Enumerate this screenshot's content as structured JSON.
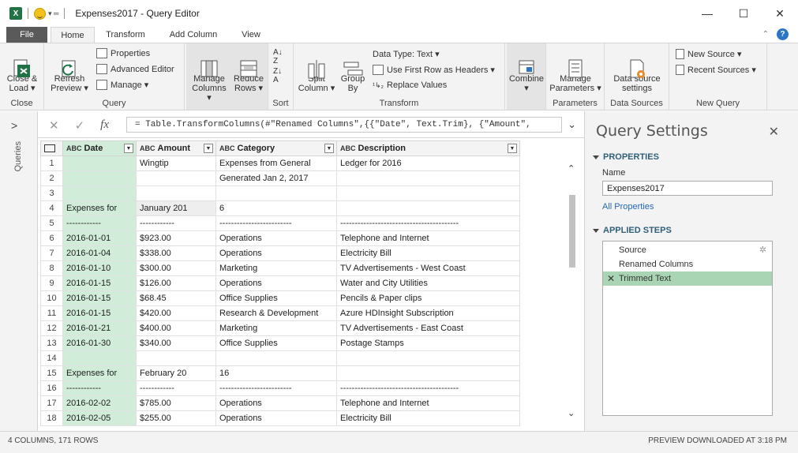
{
  "window": {
    "app_badge": "X",
    "title": "Expenses2017 - Query Editor",
    "controls": {
      "minimize": "—",
      "maximize": "☐",
      "close": "✕"
    }
  },
  "ribbon_tabs": [
    {
      "label": "File"
    },
    {
      "label": "Home"
    },
    {
      "label": "Transform"
    },
    {
      "label": "Add Column"
    },
    {
      "label": "View"
    }
  ],
  "ribbon": {
    "close_group": {
      "label": "Close",
      "close_load": "Close &\nLoad ▾"
    },
    "query_group": {
      "label": "Query",
      "refresh_preview": "Refresh\nPreview ▾",
      "properties": "Properties",
      "advanced_editor": "Advanced Editor",
      "manage": "Manage ▾"
    },
    "manage_columns": "Manage\nColumns ▾",
    "reduce_rows": "Reduce\nRows ▾",
    "sort_group": {
      "label": "Sort"
    },
    "transform_group": {
      "label": "Transform",
      "split_column": "Split\nColumn ▾",
      "group_by": "Group\nBy",
      "data_type": "Data Type: Text ▾",
      "use_first_row": "Use First Row as Headers ▾",
      "replace_values": "Replace Values"
    },
    "combine": "Combine\n▾",
    "parameters_group": {
      "label": "Parameters",
      "manage_parameters": "Manage\nParameters ▾"
    },
    "data_sources_group": {
      "label": "Data Sources",
      "data_source_settings": "Data source\nsettings"
    },
    "new_query_group": {
      "label": "New Query",
      "new_source": "New Source ▾",
      "recent_sources": "Recent Sources ▾"
    }
  },
  "queries_pane": {
    "label": "Queries",
    "chevron": ">"
  },
  "formula_bar": {
    "cancel_icon": "✕",
    "commit_icon": "✓",
    "fx_label": "fx",
    "formula": "= Table.TransformColumns(#\"Renamed Columns\",{{\"Date\", Text.Trim}, {\"Amount\","
  },
  "grid": {
    "columns": [
      {
        "type": "ABC",
        "label": "Date"
      },
      {
        "type": "ABC",
        "label": "Amount"
      },
      {
        "type": "ABC",
        "label": "Category"
      },
      {
        "type": "ABC",
        "label": "Description"
      }
    ],
    "rows": [
      {
        "n": "1",
        "date": "",
        "amount": "Wingtip",
        "category": "Expenses from General",
        "description": "Ledger for 2016"
      },
      {
        "n": "2",
        "date": "",
        "amount": "",
        "category": "Generated Jan 2, 2017",
        "description": ""
      },
      {
        "n": "3",
        "date": "",
        "amount": "",
        "category": "",
        "description": ""
      },
      {
        "n": "4",
        "date": "Expenses for",
        "amount": "January 201",
        "category": "6",
        "description": ""
      },
      {
        "n": "5",
        "date": "------------",
        "amount": "------------",
        "category": "-------------------------",
        "description": "-----------------------------------------"
      },
      {
        "n": "6",
        "date": "2016-01-01",
        "amount": "$923.00",
        "category": "Operations",
        "description": "Telephone and Internet"
      },
      {
        "n": "7",
        "date": "2016-01-04",
        "amount": "$338.00",
        "category": "Operations",
        "description": "Electricity Bill"
      },
      {
        "n": "8",
        "date": "2016-01-10",
        "amount": "$300.00",
        "category": "Marketing",
        "description": "TV Advertisements - West Coast"
      },
      {
        "n": "9",
        "date": "2016-01-15",
        "amount": "$126.00",
        "category": "Operations",
        "description": "Water and City Utilities"
      },
      {
        "n": "10",
        "date": "2016-01-15",
        "amount": "$68.45",
        "category": "Office Supplies",
        "description": "Pencils & Paper clips"
      },
      {
        "n": "11",
        "date": "2016-01-15",
        "amount": "$420.00",
        "category": "Research & Development",
        "description": "Azure HDInsight Subscription"
      },
      {
        "n": "12",
        "date": "2016-01-21",
        "amount": "$400.00",
        "category": "Marketing",
        "description": "TV Advertisements - East Coast"
      },
      {
        "n": "13",
        "date": "2016-01-30",
        "amount": "$340.00",
        "category": "Office Supplies",
        "description": "Postage Stamps"
      },
      {
        "n": "14",
        "date": "",
        "amount": "",
        "category": "",
        "description": ""
      },
      {
        "n": "15",
        "date": "Expenses for",
        "amount": "February 20",
        "category": "16",
        "description": ""
      },
      {
        "n": "16",
        "date": "------------",
        "amount": "------------",
        "category": "-------------------------",
        "description": "-----------------------------------------"
      },
      {
        "n": "17",
        "date": "2016-02-02",
        "amount": "$785.00",
        "category": "Operations",
        "description": "Telephone and Internet"
      },
      {
        "n": "18",
        "date": "2016-02-05",
        "amount": "$255.00",
        "category": "Operations",
        "description": "Electricity Bill"
      }
    ]
  },
  "query_settings": {
    "title": "Query Settings",
    "close": "✕",
    "properties_header": "PROPERTIES",
    "name_label": "Name",
    "name_value": "Expenses2017",
    "all_properties": "All Properties",
    "applied_steps_header": "APPLIED STEPS",
    "steps": [
      {
        "label": "Source",
        "has_gear": true
      },
      {
        "label": "Renamed Columns",
        "has_gear": false
      },
      {
        "label": "Trimmed Text",
        "selected": true
      }
    ]
  },
  "status": {
    "left": "4 COLUMNS, 171 ROWS",
    "right": "PREVIEW DOWNLOADED AT 3:18 PM"
  },
  "colors": {
    "accent_green": "#217346",
    "selected_column": "#d1ecd8",
    "selected_step": "#aad5b5",
    "link_blue": "#2468b6"
  }
}
